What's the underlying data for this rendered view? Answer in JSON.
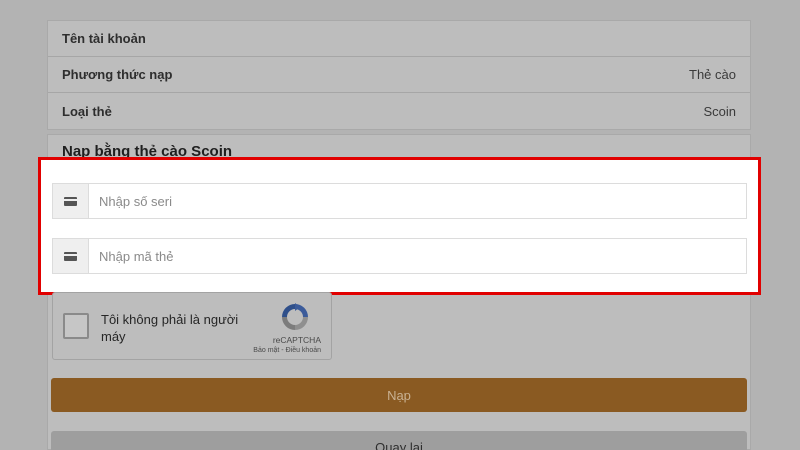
{
  "info": {
    "rows": [
      {
        "label": "Tên tài khoản",
        "value": ""
      },
      {
        "label": "Phương thức nạp",
        "value": "Thẻ cào"
      },
      {
        "label": "Loại thẻ",
        "value": "Scoin"
      }
    ]
  },
  "form": {
    "title": "Nạp bằng thẻ cào Scoin",
    "serial_placeholder": "Nhập số seri",
    "code_placeholder": "Nhập mã thẻ"
  },
  "recaptcha": {
    "label": "Tôi không phải là người máy",
    "brand": "reCAPTCHA",
    "links": "Bảo mật - Điều khoản"
  },
  "buttons": {
    "submit_label": "Nạp",
    "back_label": "Quay lại"
  },
  "colors": {
    "highlight_border": "#e10000",
    "submit_bg": "#8a5a22"
  }
}
